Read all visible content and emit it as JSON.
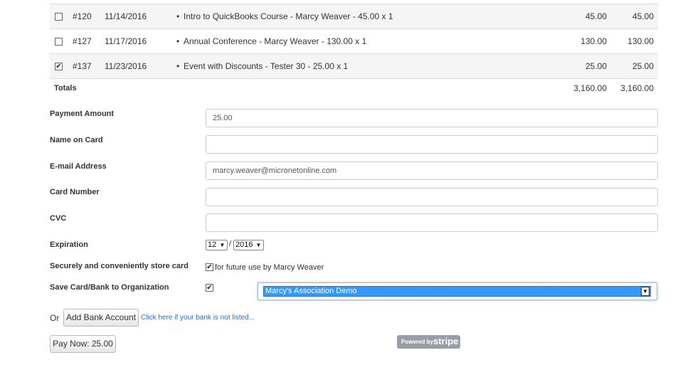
{
  "invoices": [
    {
      "checked": false,
      "number": "#120",
      "date": "11/14/2016",
      "description": "Intro to QuickBooks Course - Marcy Weaver - 45.00 x 1",
      "amount": "45.00",
      "total": "45.00"
    },
    {
      "checked": false,
      "number": "#127",
      "date": "11/17/2016",
      "description": "Annual Conference - Marcy Weaver - 130.00 x 1",
      "amount": "130.00",
      "total": "130.00"
    },
    {
      "checked": true,
      "number": "#137",
      "date": "11/23/2016",
      "description": "Event with Discounts - Tester 30 - 25.00 x 1",
      "amount": "25.00",
      "total": "25.00"
    }
  ],
  "totals": {
    "label": "Totals",
    "amount": "3,160.00",
    "total": "3,160.00"
  },
  "form": {
    "payment_amount": {
      "label": "Payment Amount",
      "value": "25.00"
    },
    "name_on_card": {
      "label": "Name on Card",
      "value": ""
    },
    "email": {
      "label": "E-mail Address",
      "value": "marcy.weaver@micronetonline.com"
    },
    "card_number": {
      "label": "Card Number",
      "value": ""
    },
    "cvc": {
      "label": "CVC",
      "value": ""
    },
    "expiration": {
      "label": "Expiration",
      "month": "12",
      "separator": "/",
      "year": "2016"
    },
    "store_card": {
      "label": "Securely and conveniently store card",
      "checked": true,
      "text": "for future use by Marcy Weaver"
    },
    "save_to_org": {
      "label": "Save Card/Bank to Organization",
      "checked": true,
      "selected_org": "Marcy's Association Demo"
    }
  },
  "bank": {
    "or_label": "Or",
    "add_bank_button": "Add Bank Account",
    "not_listed_link": "Click here if your bank is not listed..."
  },
  "pay_button": "Pay Now: 25.00",
  "badge": {
    "powered_by": "Powered by",
    "brand": "stripe"
  },
  "colors": {
    "link": "#2a6db5",
    "selection": "#3399ff",
    "badge": "#9a9ca8"
  }
}
